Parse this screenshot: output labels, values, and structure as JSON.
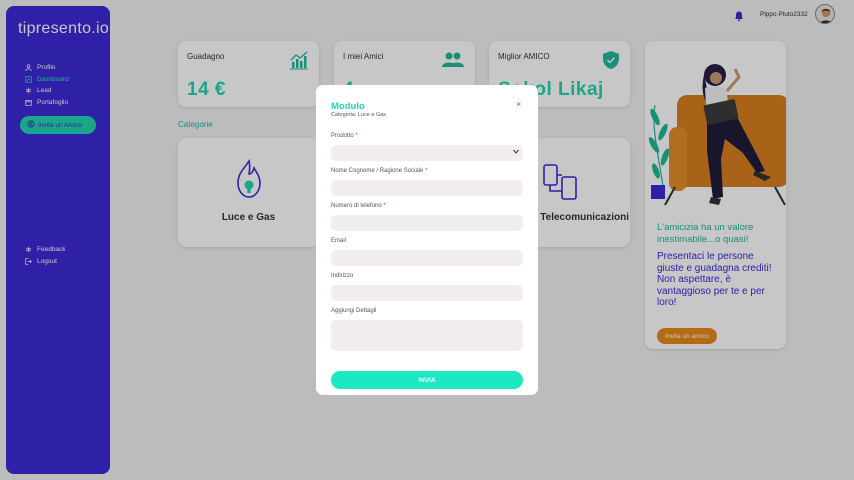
{
  "brand": {
    "name": "tipresento.io"
  },
  "sidebar": {
    "items": [
      {
        "label": "Profilo",
        "icon": "user-icon"
      },
      {
        "label": "Dashboard",
        "icon": "dashboard-icon"
      },
      {
        "label": "Lead",
        "icon": "asterisk-icon"
      },
      {
        "label": "Portafoglio",
        "icon": "wallet-icon"
      }
    ],
    "invite_label": "Invita un Amico",
    "bottom_items": [
      {
        "label": "Feedback",
        "icon": "asterisk-icon"
      },
      {
        "label": "Logout",
        "icon": "logout-icon"
      }
    ]
  },
  "topbar": {
    "username": "Pippo Pluto2332"
  },
  "stats": [
    {
      "title": "Guadagno",
      "value": "14 €",
      "icon": "chart-icon"
    },
    {
      "title": "I miei Amici",
      "value": "4",
      "icon": "friends-icon"
    },
    {
      "title": "Miglior AMICO",
      "value": "Sokol Likaj",
      "icon": "shield-icon"
    }
  ],
  "categories": {
    "title": "Categorie",
    "items": [
      {
        "label": "Luce e Gas",
        "icon": "flame-bulb-icon"
      },
      {
        "label": "Telecomunicazioni",
        "icon": "devices-icon"
      }
    ]
  },
  "promo": {
    "headline": "L'amicizia ha un valore inestimabile...o quasi!",
    "body": "Presentaci le persone giuste e guadagna crediti! Non aspettare, è vantaggioso per te e per loro!",
    "button": "Invita un amico"
  },
  "modal": {
    "title": "Modulo",
    "subtitle": "Categoria: Luce e Gas",
    "close": "×",
    "fields": {
      "prodotto": {
        "label": "Prodotto",
        "required": "*",
        "value": ""
      },
      "nome": {
        "label": "Nome Cognome / Ragione Sociale",
        "required": "*",
        "value": ""
      },
      "telefono": {
        "label": "Numero di telefono",
        "required": "*",
        "value": ""
      },
      "email": {
        "label": "Email",
        "value": ""
      },
      "indirizzo": {
        "label": "Indirizzo",
        "value": ""
      },
      "dettagli": {
        "label": "Aggiungi Dettagli",
        "value": ""
      }
    },
    "submit": "INVIA"
  },
  "colors": {
    "accent": "#20d5b0",
    "brand": "#3d2bd6",
    "promo_button": "#e88a1a",
    "required": "#e0304a"
  }
}
